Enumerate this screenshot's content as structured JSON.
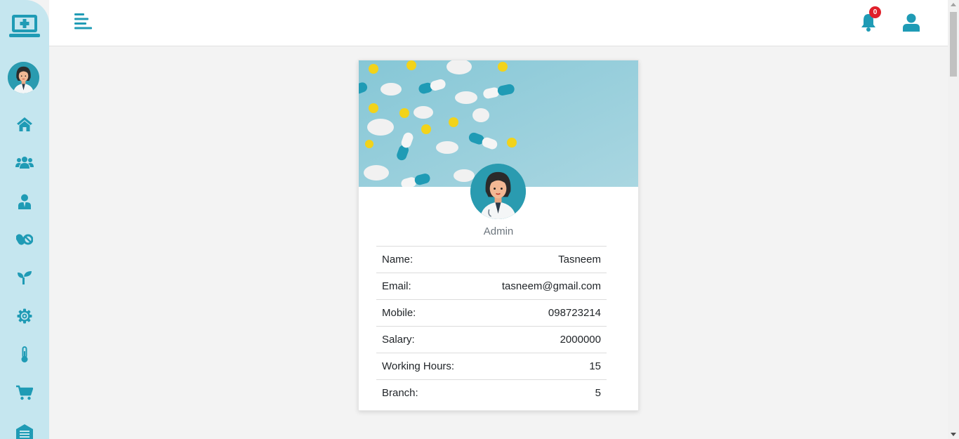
{
  "sidebar": {
    "logo": "medical-laptop-icon",
    "nav": [
      {
        "icon": "home-icon"
      },
      {
        "icon": "users-icon"
      },
      {
        "icon": "employee-icon"
      },
      {
        "icon": "pills-icon"
      },
      {
        "icon": "seedling-icon"
      },
      {
        "icon": "gear-icon"
      },
      {
        "icon": "thermometer-icon"
      },
      {
        "icon": "cart-icon"
      },
      {
        "icon": "warehouse-icon"
      }
    ]
  },
  "header": {
    "notification_count": "0"
  },
  "profile": {
    "role": "Admin",
    "fields": [
      {
        "label": "Name:",
        "value": "Tasneem"
      },
      {
        "label": "Email:",
        "value": "tasneem@gmail.com"
      },
      {
        "label": "Mobile:",
        "value": "098723214"
      },
      {
        "label": "Salary:",
        "value": "2000000"
      },
      {
        "label": "Working Hours:",
        "value": "15"
      },
      {
        "label": "Branch:",
        "value": "5"
      }
    ]
  },
  "colors": {
    "accent": "#1f9bb5",
    "sidebar_bg": "#c5e6ef",
    "badge": "#e0202b"
  }
}
